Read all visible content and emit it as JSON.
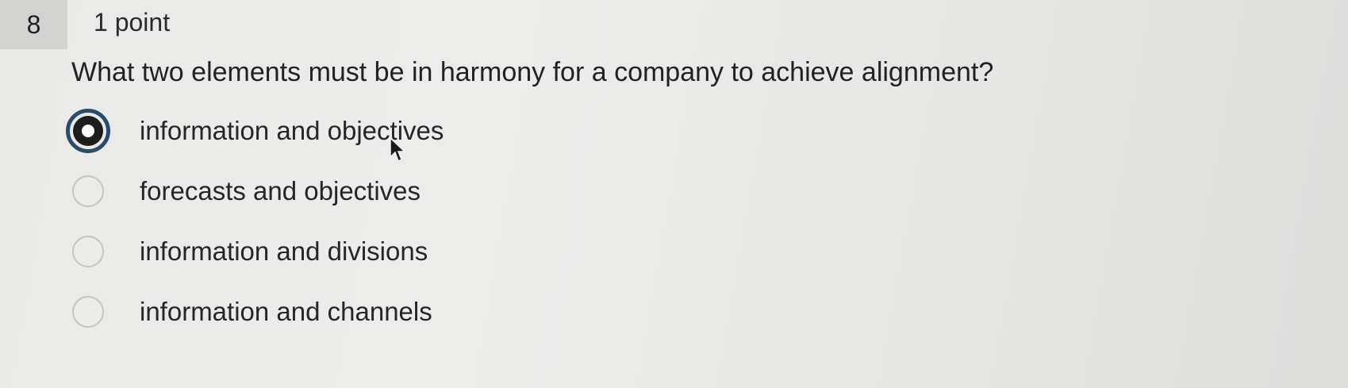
{
  "question": {
    "number": "8",
    "points": "1 point",
    "text": "What two elements must be in harmony for a company to achieve alignment?"
  },
  "options": [
    {
      "label": "information and objectives",
      "selected": true
    },
    {
      "label": "forecasts and objectives",
      "selected": false
    },
    {
      "label": "information and divisions",
      "selected": false
    },
    {
      "label": "information and channels",
      "selected": false
    }
  ],
  "colors": {
    "selected_ring": "#2a4c6c",
    "header_box": "#d3d3d1"
  },
  "icons": {
    "cursor": "arrow-cursor-icon"
  }
}
